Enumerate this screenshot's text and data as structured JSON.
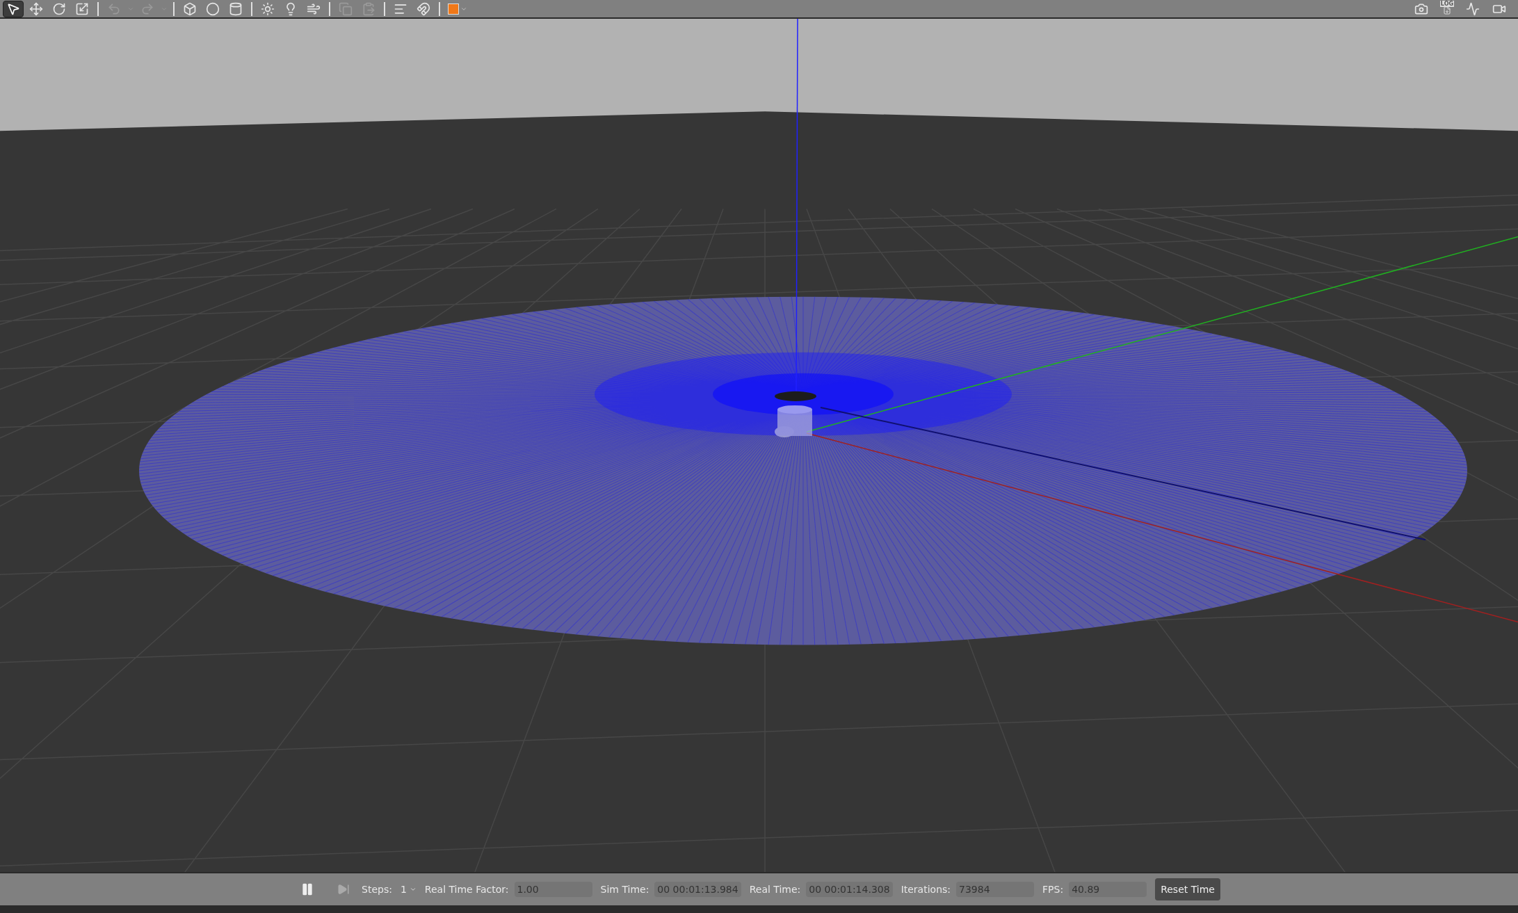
{
  "toolbar": {
    "left_tools": [
      {
        "kind": "select",
        "selected": true
      },
      {
        "kind": "translate",
        "selected": false
      },
      {
        "kind": "rotate",
        "selected": false
      },
      {
        "kind": "scale",
        "selected": false
      },
      {
        "kind": "sep"
      },
      {
        "kind": "undo",
        "selected": false
      },
      {
        "kind": "caret",
        "selected": false
      },
      {
        "kind": "redo",
        "selected": false
      },
      {
        "kind": "caret",
        "selected": false
      },
      {
        "kind": "sep"
      },
      {
        "kind": "box",
        "selected": false
      },
      {
        "kind": "sphere",
        "selected": false
      },
      {
        "kind": "cylinder",
        "selected": false
      },
      {
        "kind": "sep"
      },
      {
        "kind": "pointlight",
        "selected": false
      },
      {
        "kind": "spotlight",
        "selected": false
      },
      {
        "kind": "dirlight",
        "selected": false
      },
      {
        "kind": "sep"
      },
      {
        "kind": "copy",
        "selected": false
      },
      {
        "kind": "paste",
        "selected": false
      },
      {
        "kind": "sep"
      },
      {
        "kind": "align",
        "selected": false
      },
      {
        "kind": "magnet",
        "selected": false
      },
      {
        "kind": "sep"
      },
      {
        "kind": "view",
        "selected": false
      }
    ],
    "right_tools": [
      {
        "kind": "camera"
      },
      {
        "kind": "log",
        "label": "LOG"
      },
      {
        "kind": "plot"
      },
      {
        "kind": "video"
      }
    ]
  },
  "status_bar": {
    "paused": false,
    "steps_label": "Steps:",
    "steps_value": "1",
    "fields": [
      {
        "label": "Real Time Factor:",
        "value": "1.00"
      },
      {
        "label": "Sim Time:",
        "value": "00 00:01:13.984"
      },
      {
        "label": "Real Time:",
        "value": "00 00:01:14.308"
      },
      {
        "label": "Iterations:",
        "value": "73984"
      },
      {
        "label": "FPS:",
        "value": "40.89"
      }
    ],
    "reset_button": "Reset Time"
  }
}
